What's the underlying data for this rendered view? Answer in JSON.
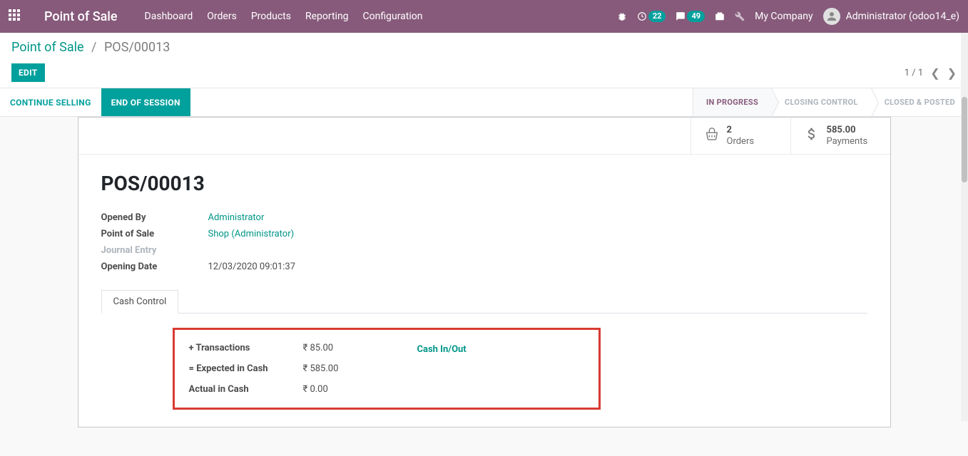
{
  "navbar": {
    "brand": "Point of Sale",
    "links": [
      "Dashboard",
      "Orders",
      "Products",
      "Reporting",
      "Configuration"
    ],
    "activity_badge": "22",
    "message_badge": "49",
    "company": "My Company",
    "user": "Administrator (odoo14_e)"
  },
  "breadcrumb": {
    "root": "Point of Sale",
    "sep": "/",
    "current": "POS/00013"
  },
  "buttons": {
    "edit": "Edit"
  },
  "pager": {
    "value": "1 / 1"
  },
  "statusbar": {
    "continue": "Continue Selling",
    "end": "End of Session",
    "stages": [
      "In Progress",
      "Closing Control",
      "Closed & Posted"
    ]
  },
  "stats": {
    "orders": {
      "value": "2",
      "label": "Orders"
    },
    "payments": {
      "value": "585.00",
      "label": "Payments"
    }
  },
  "record": {
    "title": "POS/00013",
    "opened_by_label": "Opened By",
    "opened_by": "Administrator",
    "pos_label": "Point of Sale",
    "pos": "Shop (Administrator)",
    "journal_label": "Journal Entry",
    "opening_label": "Opening Date",
    "opening": "12/03/2020 09:01:37"
  },
  "notebook": {
    "tab1": "Cash Control"
  },
  "cash": {
    "transactions_label": "+ Transactions",
    "transactions_value": "₹ 85.00",
    "expected_label": "= Expected in Cash",
    "expected_value": "₹ 585.00",
    "actual_label": "Actual in Cash",
    "actual_value": "₹ 0.00",
    "inout": "Cash In/Out"
  }
}
